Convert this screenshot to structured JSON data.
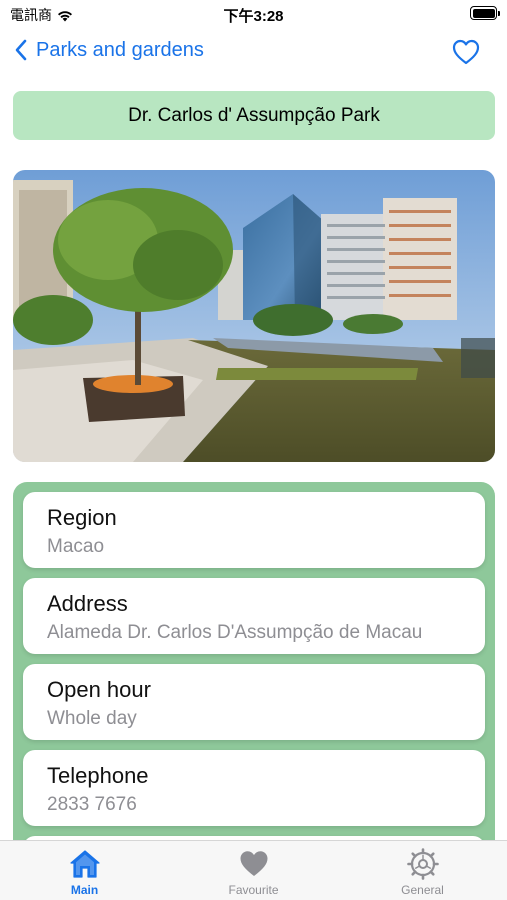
{
  "status_bar": {
    "carrier": "電訊商",
    "time": "下午3:28"
  },
  "nav": {
    "back_label": "Parks and gardens",
    "accent_color": "#1a73e8",
    "favourite_icon": "heart-outline-icon"
  },
  "park": {
    "title": "Dr. Carlos d' Assumpção Park",
    "title_bg": "#b8e6c1"
  },
  "details": [
    {
      "label": "Region",
      "value": "Macao"
    },
    {
      "label": "Address",
      "value": "Alameda Dr. Carlos D'Assumpção de Macau"
    },
    {
      "label": "Open hour",
      "value": "Whole day"
    },
    {
      "label": "Telephone",
      "value": "2833 7676"
    }
  ],
  "tabs": [
    {
      "label": "Main",
      "icon": "house-icon",
      "active": true
    },
    {
      "label": "Favourite",
      "icon": "heart-icon",
      "active": false
    },
    {
      "label": "General",
      "icon": "gear-icon",
      "active": false
    }
  ]
}
